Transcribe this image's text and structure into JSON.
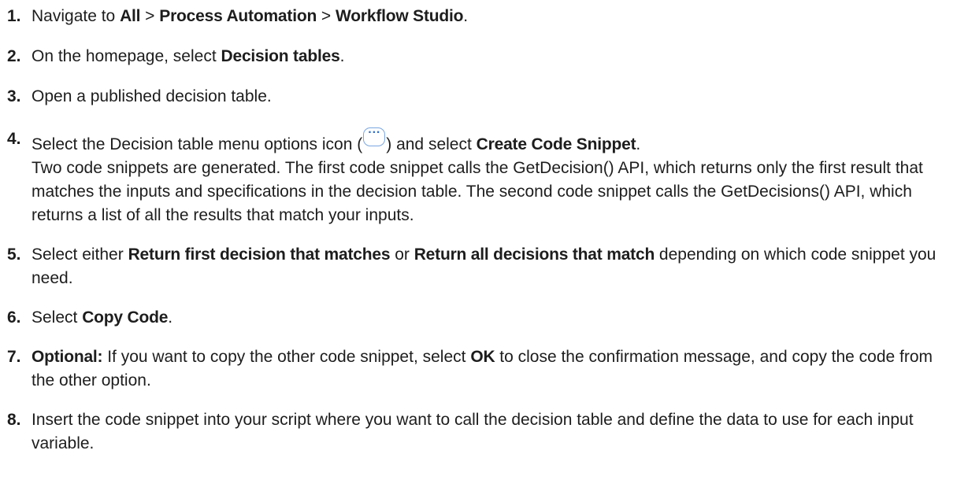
{
  "steps": [
    {
      "num": "1.",
      "parts": [
        "Navigate to ",
        "All",
        " > ",
        "Process Automation",
        " > ",
        "Workflow Studio",
        "."
      ]
    },
    {
      "num": "2.",
      "parts": [
        "On the homepage, select ",
        "Decision tables",
        "."
      ]
    },
    {
      "num": "3.",
      "parts": [
        "Open a published decision table."
      ]
    },
    {
      "num": "4.",
      "parts": [
        "Select the Decision table menu options icon (",
        ") and select ",
        "Create Code Snippet",
        "."
      ],
      "icon_glyph": "···",
      "icon_name": "more-options-icon",
      "detail": "Two code snippets are generated. The first code snippet calls the GetDecision() API, which returns only the first result that matches the inputs and specifications in the decision table. The second code snippet calls the GetDecisions() API, which returns a list of all the results that match your inputs."
    },
    {
      "num": "5.",
      "parts": [
        "Select either ",
        "Return first decision that matches",
        " or ",
        "Return all decisions that match",
        " depending on which code snippet you need."
      ]
    },
    {
      "num": "6.",
      "parts": [
        "Select ",
        "Copy Code",
        "."
      ]
    },
    {
      "num": "7.",
      "parts": [
        "Optional:",
        " If you want to copy the other code snippet, select ",
        "OK",
        " to close the confirmation message, and copy the code from the other option."
      ]
    },
    {
      "num": "8.",
      "parts": [
        "Insert the code snippet into your script where you want to call the decision table and define the data to use for each input variable."
      ]
    }
  ],
  "colors": {
    "text": "#1d1d1d",
    "icon_border": "#7aa6e0",
    "icon_glyph": "#2f6fd0"
  }
}
